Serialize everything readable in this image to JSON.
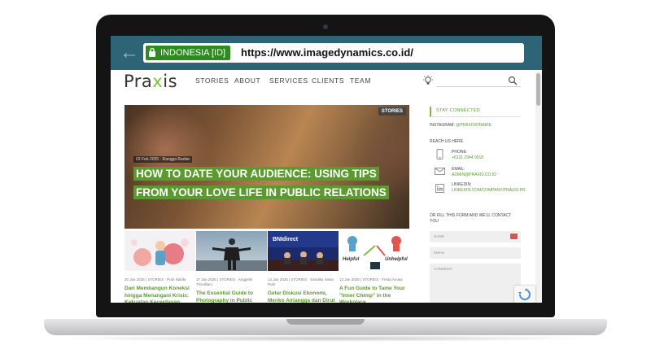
{
  "browser": {
    "back_icon": "arrow-left-icon",
    "ev_label": "INDONESIA [ID]",
    "url": "https://www.imagedynamics.co.id/",
    "lock_icon": "padlock-icon"
  },
  "site": {
    "logo_prefix": "Pra",
    "logo_x": "x",
    "logo_suffix": "is",
    "nav": [
      "STORIES",
      "ABOUT",
      "SERVICES",
      "CLIENTS",
      "TEAM"
    ],
    "search_icon": "magnifier-icon",
    "idea_icon": "lightbulb-icon"
  },
  "hero": {
    "tag": "STORIES",
    "meta": "03 Feb 2025 · Rangga Radiar",
    "title": "HOW TO DATE YOUR AUDIENCE: USING TIPS FROM YOUR LOVE LIFE IN PUBLIC RELATIONS"
  },
  "cards": [
    {
      "meta": "20 Jan 2025 | STORIES · Putri Nabila",
      "title": "Dari Membangun Koneksi hingga Menangani Krisis: Kekuatan Kecerdasan"
    },
    {
      "meta": "17 Jan 2025 | STORIES · Anggelin Trisvilliani",
      "title": "The Essential Guide to Photography in Public Relations"
    },
    {
      "meta": "14 Jan 2025 | STORIES · Sandika Vania Putri",
      "title": "Gelar Diskusi Ekonomi, Menko Airlangga dan Dirut BNI Bahas Tantangan"
    },
    {
      "meta": "13 Jan 2025 | STORIES · Freda Amaia",
      "title": "A Fun Guide to Tame Your \"Inner Chimp\" in the Workplace"
    }
  ],
  "card_images": {
    "bni_label": "BNIdirect",
    "helpful": "Helpful",
    "unhelpful": "Unhelpful"
  },
  "sidebar": {
    "stay_connected": "STAY CONNECTED",
    "instagram_label": "INSTAGRAM:",
    "instagram_value": "@PRAXISIONAIRE",
    "reach_us": "REACH US HERE",
    "phone_label": "PHONE:",
    "phone_value": "+6221 2944 9018",
    "email_label": "EMAIL:",
    "email_value": "ADMIN@PRAXIS.CO.ID",
    "linkedin_label": "LINKEDIN:",
    "linkedin_value": "LINKEDIN.COM/COMPANY/PRAXIS-PR",
    "form_intro": "OR FILL THIS FORM AND WE'LL CONTACT YOU",
    "name_placeholder": "NAME",
    "email_placeholder": "EMAIL",
    "comment_placeholder": "COMMENT"
  },
  "colors": {
    "brand_green": "#5b9a2f",
    "browser_bar": "#2d6476",
    "ev_green": "#2e8b1f"
  }
}
